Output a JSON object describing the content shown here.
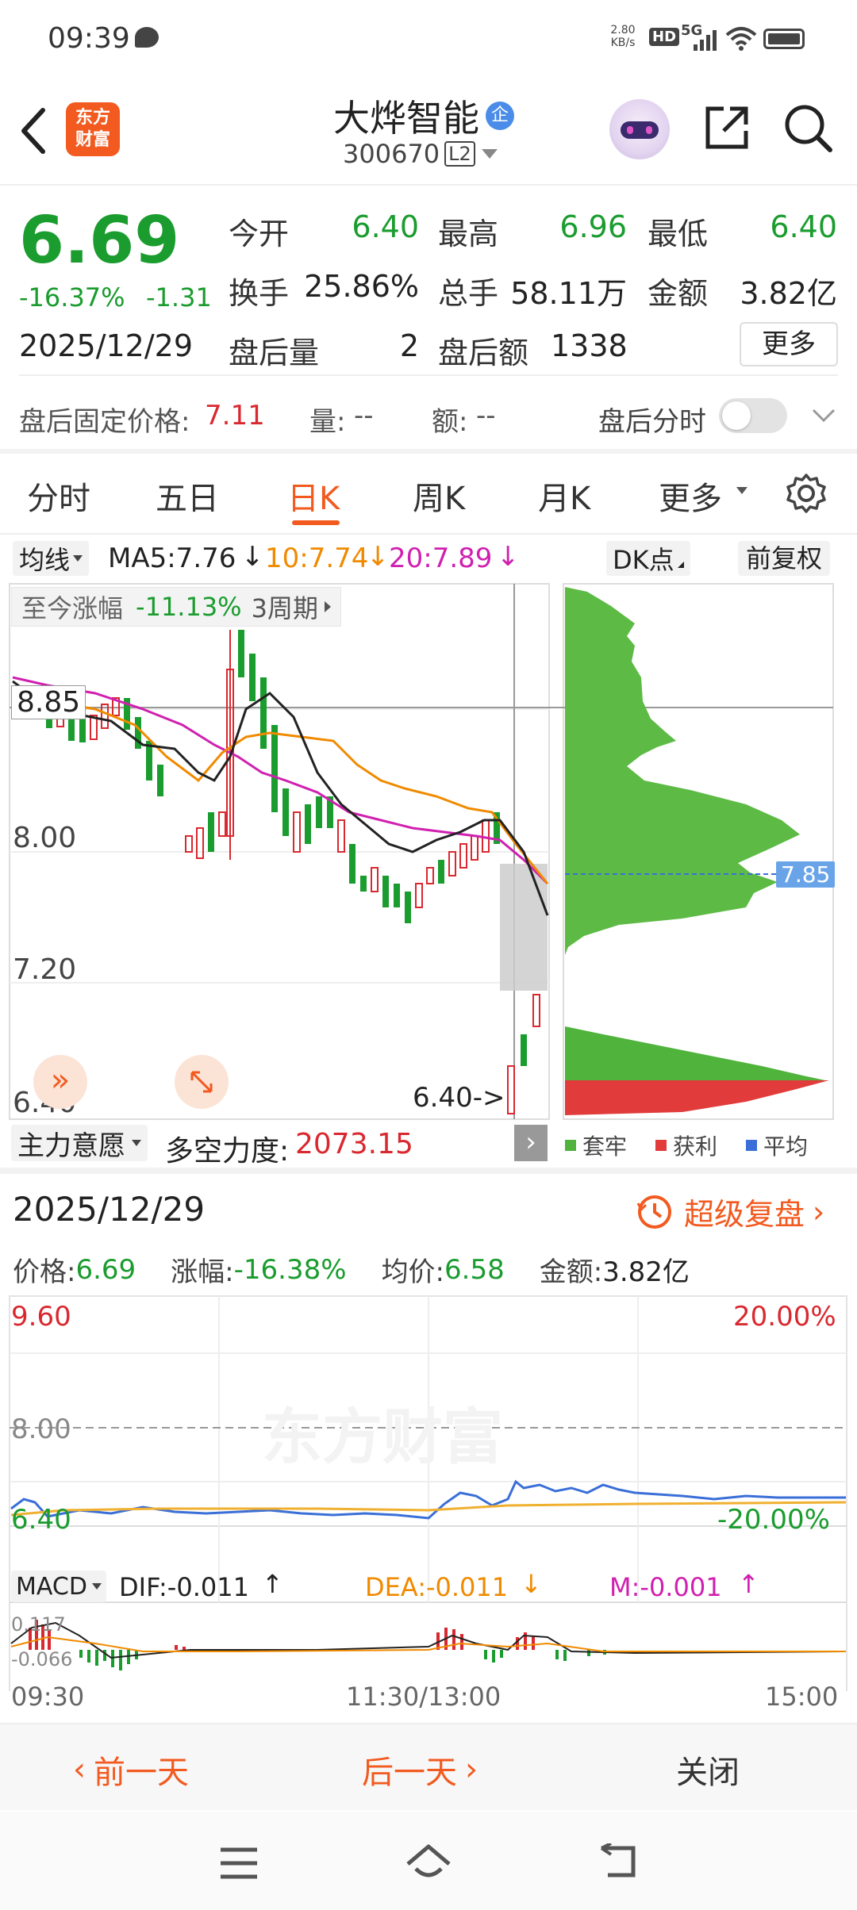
{
  "status_bar": {
    "time": "09:39",
    "net_speed_top": "2.80",
    "net_speed_unit": "KB/s",
    "hd": "HD",
    "signal": "5G"
  },
  "header": {
    "logo_line1": "东方",
    "logo_line2": "财富",
    "stock_name": "大烨智能",
    "badge": "企",
    "code": "300670",
    "level": "L2"
  },
  "quote": {
    "price": "6.69",
    "change_pct": "-16.37%",
    "change_abs": "-1.31",
    "date": "2025/12/29",
    "fields": [
      {
        "label": "今开",
        "value": "6.40",
        "color": "green"
      },
      {
        "label": "最高",
        "value": "6.96",
        "color": "green"
      },
      {
        "label": "最低",
        "value": "6.40",
        "color": "green"
      },
      {
        "label": "换手",
        "value": "25.86%",
        "color": "dark"
      },
      {
        "label": "总手",
        "value": "58.11万",
        "color": "dark"
      },
      {
        "label": "金额",
        "value": "3.82亿",
        "color": "dark"
      },
      {
        "label": "盘后量",
        "value": "2",
        "color": "dark"
      },
      {
        "label": "盘后额",
        "value": "1338",
        "color": "dark"
      }
    ],
    "more_button": "更多",
    "after_fixed_label": "盘后固定价格:",
    "after_fixed_value": "7.11",
    "vol_label": "量:",
    "vol_value": "--",
    "amt_label": "额:",
    "amt_value": "--",
    "after_time_label": "盘后分时"
  },
  "tabs": {
    "items": [
      "分时",
      "五日",
      "日K",
      "周K",
      "月K",
      "更多"
    ],
    "active": 2
  },
  "ma_bar": {
    "selector": "均线",
    "ma5": "MA5:7.76",
    "ma10": "10:7.74",
    "ma20": "20:7.89",
    "dk": "DK点",
    "adjust": "前复权"
  },
  "kline": {
    "range_label": "至今涨幅",
    "range_value": "-11.13%",
    "period": "3周期",
    "price_labels": [
      "8.85",
      "8.00",
      "7.20",
      "6.40"
    ],
    "low_marker": "6.40->",
    "chip_price": "7.85",
    "indicator": "主力意愿",
    "power_label": "多空力度:",
    "power_value": "2073.15",
    "legend": [
      "套牢",
      "获利",
      "平均"
    ]
  },
  "replay": {
    "date": "2025/12/29",
    "super_replay": "超级复盘",
    "price_label": "价格:",
    "price": "6.69",
    "chg_label": "涨幅:",
    "chg": "-16.38%",
    "avg_label": "均价:",
    "avg": "6.58",
    "amt_label": "金额:",
    "amt": "3.82亿",
    "y_top": "9.60",
    "y_mid": "8.00",
    "y_bot": "6.40",
    "pct_top": "20.00%",
    "pct_bot": "-20.00%",
    "macd_sel": "MACD",
    "dif": "DIF:-0.011",
    "dea": "DEA:-0.011",
    "m": "M:-0.001",
    "macd_top": "0.117",
    "macd_bot": "-0.066",
    "t_start": "09:30",
    "t_mid": "11:30/13:00",
    "t_end": "15:00",
    "watermark": "东方财富"
  },
  "bottom_actions": {
    "prev": "前一天",
    "next": "后一天",
    "close": "关闭"
  }
}
